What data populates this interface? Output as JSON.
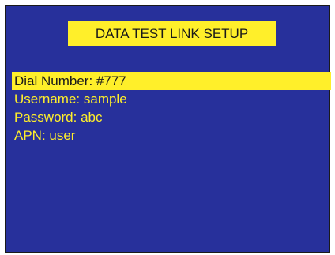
{
  "screen": {
    "title": "DATA TEST LINK SETUP",
    "colors": {
      "background": "#27309b",
      "highlight": "#ffef2a",
      "text_on_highlight": "#1a1a1a",
      "text": "#ffef2a"
    }
  },
  "menu": {
    "selected_index": 0,
    "items": [
      {
        "label": "Dial Number: #777"
      },
      {
        "label": "Username: sample"
      },
      {
        "label": "Password: abc"
      },
      {
        "label": "APN: user"
      }
    ]
  }
}
